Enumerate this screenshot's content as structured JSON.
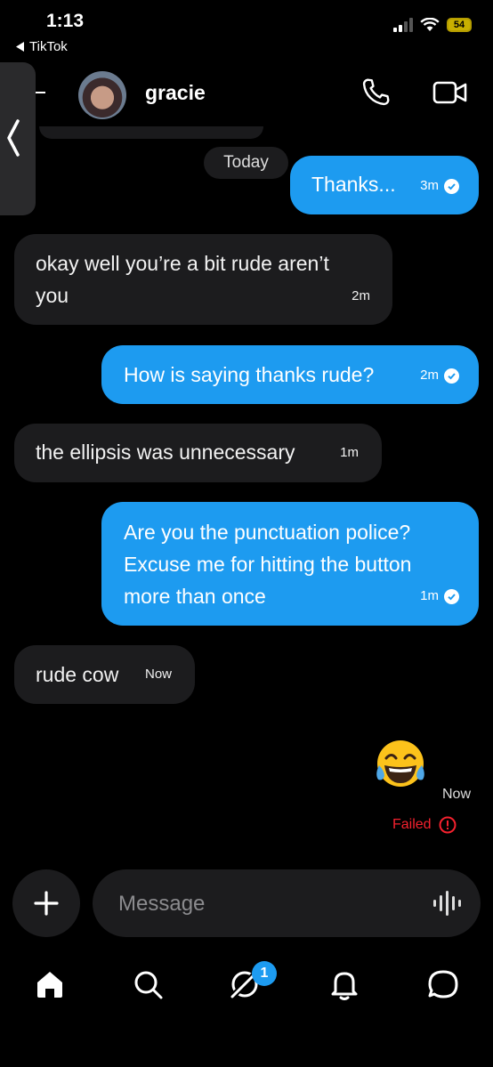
{
  "status_bar": {
    "time": "1:13",
    "back_app": "TikTok",
    "battery": "54"
  },
  "header": {
    "contact_name": "gracie"
  },
  "date_divider": "Today",
  "messages": [
    {
      "direction": "out",
      "text": "Thanks...",
      "time": "3m"
    },
    {
      "direction": "in",
      "text_lines": [
        "okay well you’re a bit rude aren’t",
        "you"
      ],
      "time": "2m"
    },
    {
      "direction": "out",
      "text": "How is saying thanks rude?",
      "time": "2m"
    },
    {
      "direction": "in",
      "text": "the ellipsis was unnecessary",
      "time": "1m"
    },
    {
      "direction": "out",
      "text_lines": [
        "Are you the punctuation police?",
        "Excuse me for hitting the button",
        "more than once"
      ],
      "time": "1m"
    },
    {
      "direction": "in",
      "text": "rude cow",
      "time": "Now"
    },
    {
      "direction": "out",
      "emoji": "😂",
      "time": "Now",
      "status": "Failed"
    }
  ],
  "composer": {
    "placeholder": "Message"
  },
  "nav": {
    "messages_badge": "1"
  },
  "colors": {
    "outgoing": "#1d9bf0",
    "incoming": "#1c1c1e",
    "failed": "#f4212e"
  },
  "icons": [
    "chevron-left-icon",
    "phone-icon",
    "video-icon",
    "check-circle-icon",
    "info-icon",
    "plus-icon",
    "voice-icon",
    "home-icon",
    "search-icon",
    "grok-icon",
    "bell-icon",
    "chat-icon"
  ]
}
